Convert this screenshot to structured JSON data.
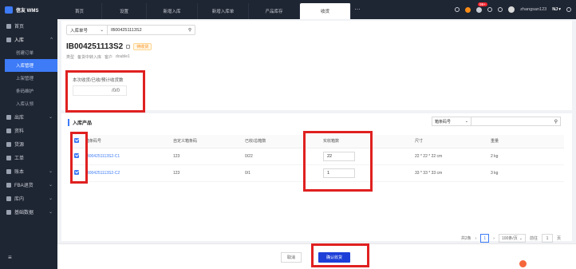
{
  "app": {
    "name": "信友 WMS"
  },
  "sidebar": {
    "items": [
      {
        "label": "首页",
        "icon": "home-icon"
      },
      {
        "label": "入库",
        "icon": "inbound-icon",
        "open": true
      },
      {
        "label": "出库",
        "icon": "outbound-icon"
      },
      {
        "label": "资料",
        "icon": "data-icon"
      },
      {
        "label": "货源",
        "icon": "source-icon"
      },
      {
        "label": "工单",
        "icon": "ticket-icon"
      },
      {
        "label": "账本",
        "icon": "ledger-icon"
      },
      {
        "label": "FBA退货",
        "icon": "return-icon"
      },
      {
        "label": "库内",
        "icon": "warehouse-icon"
      },
      {
        "label": "基础数据",
        "icon": "base-data-icon"
      }
    ],
    "sub_items": [
      "创建订单",
      "入库管理",
      "上架管理",
      "条码维护",
      "入库认领"
    ],
    "active_sub": "入库管理"
  },
  "tabs": [
    "首页",
    "设置",
    "新增入库",
    "新增入库单",
    "产品库存",
    "收货"
  ],
  "active_tab": "收货",
  "topbar": {
    "badge": "99+",
    "username": "zhangsan123",
    "region": "NJ"
  },
  "search": {
    "type_label": "入库单号",
    "value": "IB004251113S2"
  },
  "order": {
    "number": "IB004251113S2",
    "status": "待收货",
    "type_label": "类型",
    "type_value": "备货中转入库",
    "customer_label": "客户",
    "customer_value": "double1"
  },
  "receive_summary": {
    "label": "本次收货/已收/预计收货数",
    "value": "/0/0"
  },
  "products": {
    "title": "入库产品",
    "filter_label": "箱条码号",
    "columns": [
      "箱条码号",
      "自定义箱条码",
      "已收/总箱数",
      "实收箱数",
      "尺寸",
      "重量"
    ],
    "rows": [
      {
        "box_no": "IB004251113S2-C1",
        "custom": "123",
        "received": "0/22",
        "input": "22",
        "size": "22 * 22 * 22 cm",
        "weight": "2 kg"
      },
      {
        "box_no": "IB004251113S2-C2",
        "custom": "123",
        "received": "0/1",
        "input": "1",
        "size": "33 * 33 * 33 cm",
        "weight": "3 kg"
      }
    ]
  },
  "pagination": {
    "total": "共2条",
    "page": "1",
    "page_size": "100条/页",
    "goto_label": "前往",
    "goto_value": "1",
    "page_suffix": "页"
  },
  "footer": {
    "cancel": "取消",
    "confirm": "确认收货"
  },
  "colors": {
    "sidebar_bg": "#1f2633",
    "accent": "#3d7bf7",
    "confirm_bg": "#1d3fd8",
    "annotation_red": "#e02020"
  }
}
